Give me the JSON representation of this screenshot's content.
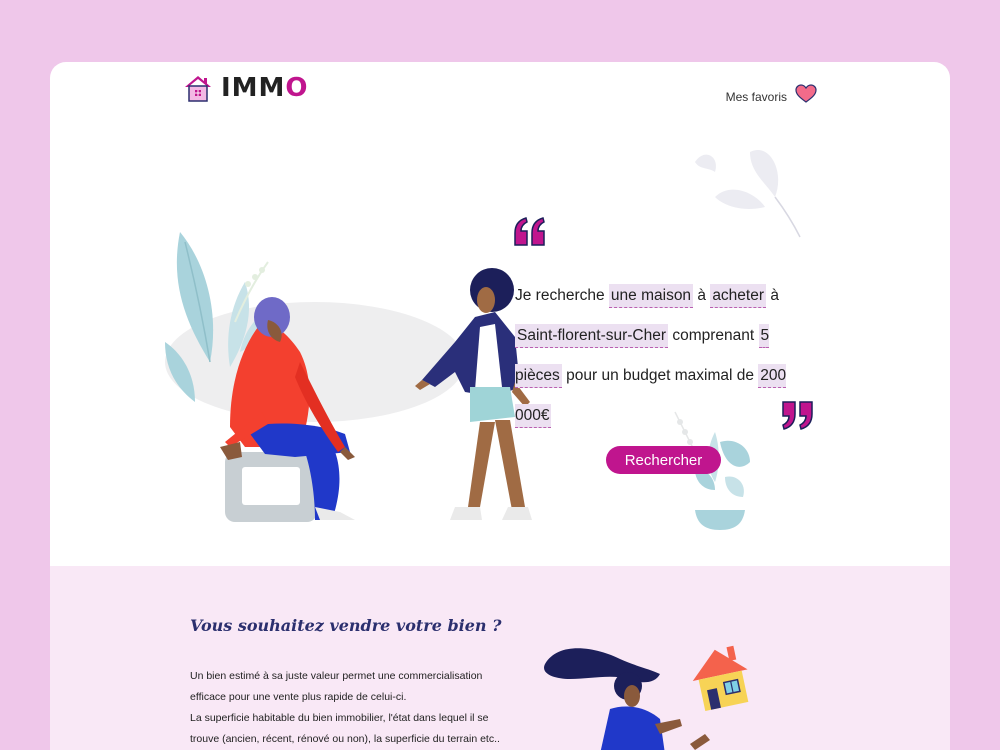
{
  "header": {
    "logo_text_main": "IMM",
    "logo_text_accent": "O",
    "favorites_label": "Mes favoris"
  },
  "search": {
    "prefix": "Je recherche",
    "property_type": "une maison",
    "connector_1": "à",
    "transaction": "acheter",
    "connector_2": "à",
    "city": "Saint-florent-sur-Cher",
    "connector_3": "comprenant",
    "rooms": "5 pièces",
    "connector_4": "pour un budget maximal de",
    "budget": "200 000€",
    "button_label": "Rechercher"
  },
  "sell": {
    "title": "Vous souhaitez vendre votre bien ?",
    "paragraph_line_1": "Un bien estimé à sa juste valeur permet une commercialisation efficace pour une vente plus rapide de celui-ci.",
    "paragraph_line_2": "La superficie habitable du bien immobilier, l'état dans lequel il se trouve (ancien, récent, rénové ou non), la superficie du terrain etc.."
  },
  "colors": {
    "page_bg": "#efc7ea",
    "accent": "#c0158e",
    "field_bg": "#ece0f1",
    "section_bg": "#f9e8f6",
    "title_color": "#2b2f6e"
  },
  "icons": [
    "house-logo-icon",
    "heart-icon",
    "open-quote-icon",
    "close-quote-icon"
  ]
}
